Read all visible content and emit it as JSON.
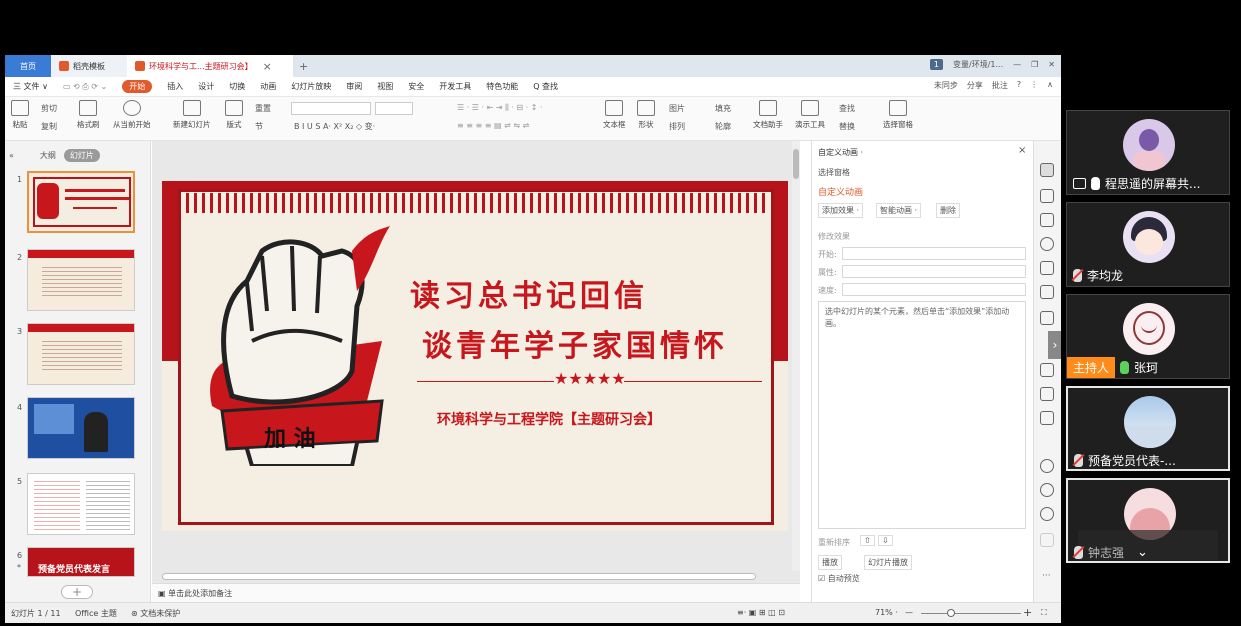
{
  "tabbar": {
    "home": "首页",
    "template_tab": "稻壳模板",
    "doc_tab": "环境科学与工...主题研习会】",
    "add": "+",
    "page_badge": "1",
    "right_label": "变量/环境/1...",
    "colors": {
      "home_bg": "#3a7bd5",
      "accent": "#e05a2b"
    }
  },
  "menubar": {
    "file": "三 文件 ∨",
    "items": [
      "开始",
      "插入",
      "设计",
      "切换",
      "动画",
      "幻灯片放映",
      "审阅",
      "视图",
      "安全",
      "开发工具",
      "特色功能",
      "Q 查找"
    ],
    "active_index": 0,
    "right": [
      "未同步",
      "分享",
      "批注"
    ]
  },
  "ribbon": {
    "paste": "粘贴",
    "cut": "剪切",
    "copy": "复制",
    "format_painter": "格式刷",
    "play_from_current": "从当前开始",
    "new_slide": "新建幻灯片",
    "layout": "版式",
    "section": "节",
    "reset": "重置",
    "bold_row": "B I U S A· X² X₂ ◇ 变·",
    "textbox": "文本框",
    "shape": "形状",
    "arrange": "排列",
    "picture": "图片",
    "fill": "填充",
    "outline": "轮廓",
    "text_assist": "文档助手",
    "presentation_tools": "演示工具",
    "find": "查找",
    "replace": "替换",
    "select_pane": "选择窗格"
  },
  "left_panel": {
    "outline_tab": "大纲",
    "slides_tab": "幻灯片",
    "slide_numbers": [
      "1",
      "2",
      "3",
      "4",
      "5",
      "6"
    ],
    "slide6_label": "预备党员代表发言",
    "star": "*"
  },
  "slide": {
    "title_line1": "读习总书记回信",
    "title_line2": "谈青年学子家国情怀",
    "stars": "★★★★★",
    "subtitle": "环境科学与工程学院【主题研习会】",
    "fist_label": "加 油"
  },
  "notes": {
    "placeholder": "单击此处添加备注"
  },
  "right_panel": {
    "title": "自定义动画 ·",
    "select_pane": "选择窗格",
    "custom_anim": "自定义动画",
    "add_effect": "添加效果 ·",
    "smart_anim": "智能动画 ·",
    "delete": "删除",
    "modify_effect": "修改效果",
    "start": "开始:",
    "property": "属性:",
    "speed": "速度:",
    "hint": "选中幻灯片的某个元素，然后单击“添加效果”添加动画。",
    "reorder": "重新排序",
    "play": "播放",
    "slideshow": "幻灯片播放",
    "autopreview": "自动预览"
  },
  "statusbar": {
    "slide_count": "幻灯片 1 / 11",
    "theme": "Office 主题",
    "protect": "文档未保护",
    "zoom": "71% ·"
  },
  "participants": [
    {
      "name": "程思遥的屏幕共...",
      "mic": "active",
      "sharing": true
    },
    {
      "name": "李均龙",
      "mic": "muted"
    },
    {
      "name": "张珂",
      "mic": "active",
      "host_label": "主持人"
    },
    {
      "name": "预备党员代表-...",
      "mic": "muted"
    },
    {
      "name": "钟志强",
      "mic": "muted"
    }
  ]
}
